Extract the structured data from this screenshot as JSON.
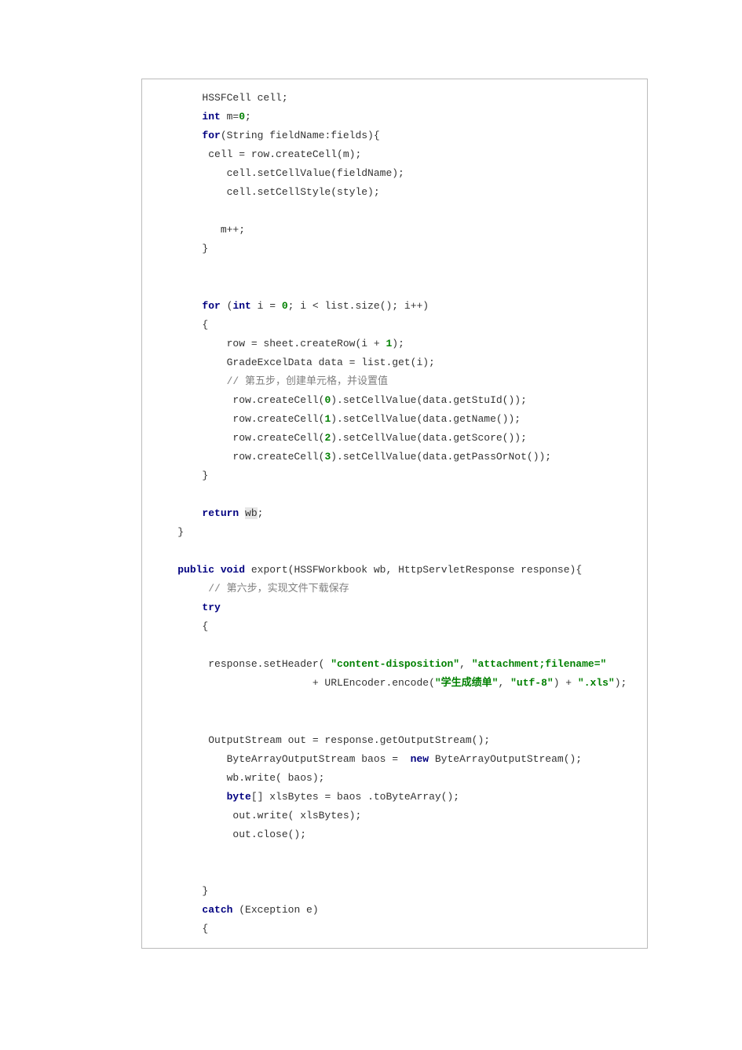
{
  "code": {
    "lines": [
      [
        {
          "t": "        HSSFCell cell;",
          "c": ""
        }
      ],
      [
        {
          "t": "        ",
          "c": ""
        },
        {
          "t": "int",
          "c": "kw"
        },
        {
          "t": " m=",
          "c": ""
        },
        {
          "t": "0",
          "c": "str"
        },
        {
          "t": ";",
          "c": ""
        }
      ],
      [
        {
          "t": "        ",
          "c": ""
        },
        {
          "t": "for",
          "c": "kw"
        },
        {
          "t": "(String fieldName:fields){",
          "c": ""
        }
      ],
      [
        {
          "t": "         cell = row.createCell(m);",
          "c": ""
        }
      ],
      [
        {
          "t": "            cell.setCellValue(fieldName);",
          "c": ""
        }
      ],
      [
        {
          "t": "            cell.setCellStyle(style);",
          "c": ""
        }
      ],
      [
        {
          "t": "",
          "c": ""
        }
      ],
      [
        {
          "t": "           m++;",
          "c": ""
        }
      ],
      [
        {
          "t": "        }",
          "c": ""
        }
      ],
      [
        {
          "t": "",
          "c": ""
        }
      ],
      [
        {
          "t": "",
          "c": ""
        }
      ],
      [
        {
          "t": "        ",
          "c": ""
        },
        {
          "t": "for",
          "c": "kw"
        },
        {
          "t": " (",
          "c": ""
        },
        {
          "t": "int",
          "c": "kw"
        },
        {
          "t": " i = ",
          "c": ""
        },
        {
          "t": "0",
          "c": "str"
        },
        {
          "t": "; i < list.size(); i++)",
          "c": ""
        }
      ],
      [
        {
          "t": "        {",
          "c": ""
        }
      ],
      [
        {
          "t": "            row = sheet.createRow(i + ",
          "c": ""
        },
        {
          "t": "1",
          "c": "str"
        },
        {
          "t": ");",
          "c": ""
        }
      ],
      [
        {
          "t": "            GradeExcelData data = list.get(i);",
          "c": ""
        }
      ],
      [
        {
          "t": "            ",
          "c": ""
        },
        {
          "t": "// 第五步，创建单元格，并设置值",
          "c": "cm"
        }
      ],
      [
        {
          "t": "             row.createCell(",
          "c": ""
        },
        {
          "t": "0",
          "c": "str"
        },
        {
          "t": ").setCellValue(data.getStuId());",
          "c": ""
        }
      ],
      [
        {
          "t": "             row.createCell(",
          "c": ""
        },
        {
          "t": "1",
          "c": "str"
        },
        {
          "t": ").setCellValue(data.getName());",
          "c": ""
        }
      ],
      [
        {
          "t": "             row.createCell(",
          "c": ""
        },
        {
          "t": "2",
          "c": "str"
        },
        {
          "t": ").setCellValue(data.getScore());",
          "c": ""
        }
      ],
      [
        {
          "t": "             row.createCell(",
          "c": ""
        },
        {
          "t": "3",
          "c": "str"
        },
        {
          "t": ").setCellValue(data.getPassOrNot());",
          "c": ""
        }
      ],
      [
        {
          "t": "        }",
          "c": ""
        }
      ],
      [
        {
          "t": "",
          "c": ""
        }
      ],
      [
        {
          "t": "        ",
          "c": ""
        },
        {
          "t": "return",
          "c": "kw"
        },
        {
          "t": " ",
          "c": ""
        },
        {
          "t": "wb",
          "c": "hl"
        },
        {
          "t": ";",
          "c": ""
        }
      ],
      [
        {
          "t": "    }",
          "c": ""
        }
      ],
      [
        {
          "t": "",
          "c": ""
        }
      ],
      [
        {
          "t": "    ",
          "c": ""
        },
        {
          "t": "public void",
          "c": "kw"
        },
        {
          "t": " export(HSSFWorkbook wb, HttpServletResponse response){",
          "c": ""
        }
      ],
      [
        {
          "t": "         ",
          "c": ""
        },
        {
          "t": "// 第六步，实现文件下载保存",
          "c": "cm"
        }
      ],
      [
        {
          "t": "        ",
          "c": ""
        },
        {
          "t": "try",
          "c": "kw"
        }
      ],
      [
        {
          "t": "        {",
          "c": ""
        }
      ],
      [
        {
          "t": "",
          "c": ""
        }
      ],
      [
        {
          "t": "         response.setHeader( ",
          "c": ""
        },
        {
          "t": "\"content-disposition\"",
          "c": "str"
        },
        {
          "t": ", ",
          "c": ""
        },
        {
          "t": "\"attachment;filename=\"",
          "c": "str"
        }
      ],
      [
        {
          "t": "                          + URLEncoder.",
          "c": ""
        },
        {
          "t": "encode",
          "c": ""
        },
        {
          "t": "(",
          "c": ""
        },
        {
          "t": "\"学生成绩单\"",
          "c": "str"
        },
        {
          "t": ", ",
          "c": ""
        },
        {
          "t": "\"utf-8\"",
          "c": "str"
        },
        {
          "t": ") + ",
          "c": ""
        },
        {
          "t": "\".xls\"",
          "c": "str"
        },
        {
          "t": ");",
          "c": ""
        }
      ],
      [
        {
          "t": "",
          "c": ""
        }
      ],
      [
        {
          "t": "",
          "c": ""
        }
      ],
      [
        {
          "t": "         OutputStream out = response.getOutputStream();",
          "c": ""
        }
      ],
      [
        {
          "t": "            ByteArrayOutputStream baos =  ",
          "c": ""
        },
        {
          "t": "new",
          "c": "kw"
        },
        {
          "t": " ByteArrayOutputStream();",
          "c": ""
        }
      ],
      [
        {
          "t": "            wb.write( baos);",
          "c": ""
        }
      ],
      [
        {
          "t": "            ",
          "c": ""
        },
        {
          "t": "byte",
          "c": "kw"
        },
        {
          "t": "[] xlsBytes = baos .toByteArray();",
          "c": ""
        }
      ],
      [
        {
          "t": "             out.write( xlsBytes);",
          "c": ""
        }
      ],
      [
        {
          "t": "             out.close();",
          "c": ""
        }
      ],
      [
        {
          "t": "",
          "c": ""
        }
      ],
      [
        {
          "t": "",
          "c": ""
        }
      ],
      [
        {
          "t": "        }",
          "c": ""
        }
      ],
      [
        {
          "t": "        ",
          "c": ""
        },
        {
          "t": "catch",
          "c": "kw"
        },
        {
          "t": " (Exception e)",
          "c": ""
        }
      ],
      [
        {
          "t": "        {",
          "c": ""
        }
      ]
    ]
  }
}
